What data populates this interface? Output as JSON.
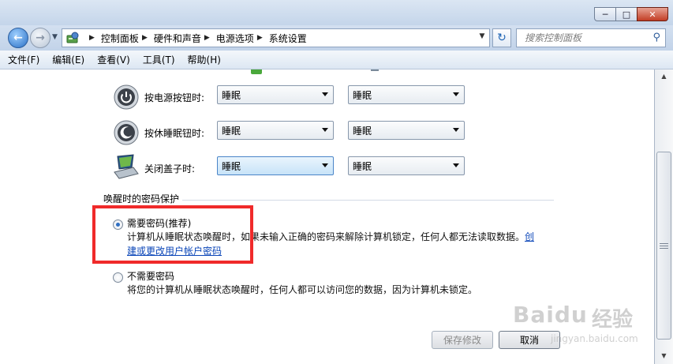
{
  "window": {
    "caption_buttons": {
      "minimize": "─",
      "maximize": "□",
      "close": "✕"
    }
  },
  "address": {
    "breadcrumbs": [
      "控制面板",
      "硬件和声音",
      "电源选项",
      "系统设置"
    ]
  },
  "search": {
    "placeholder": "搜索控制面板"
  },
  "menu": [
    "文件(F)",
    "编辑(E)",
    "查看(V)",
    "工具(T)",
    "帮助(H)"
  ],
  "power_settings": [
    {
      "label": "按电源按钮时:",
      "battery": "睡眠",
      "plugged": "睡眠",
      "icon": "power-button-icon"
    },
    {
      "label": "按休睡眠钮时:",
      "battery": "睡眠",
      "plugged": "睡眠",
      "icon": "sleep-button-icon"
    },
    {
      "label": "关闭盖子时:",
      "battery": "睡眠",
      "plugged": "睡眠",
      "icon": "laptop-lid-icon"
    }
  ],
  "password_group": {
    "title": "唤醒时的密码保护",
    "options": [
      {
        "label": "需要密码(推荐)",
        "selected": true,
        "desc_line1": "计算机从睡眠状态唤醒时，如果未输入正确的密码来解除计算机锁定，任何人都无法读取数据。",
        "link_part1": "创",
        "link_part2": "建或更改用户帐户密码"
      },
      {
        "label": "不需要密码",
        "selected": false,
        "desc_line1": "将您的计算机从睡眠状态唤醒时，任何人都可以访问您的数据，因为计算机未锁定。"
      }
    ]
  },
  "buttons": {
    "save": "保存修改",
    "cancel": "取消"
  },
  "watermark": {
    "brand": "Baidu",
    "brand_cn": "经验",
    "url": "jingyan.baidu.com"
  },
  "colors": {
    "highlight_box": "#f02a2a",
    "link": "#0b46b8",
    "radio_dot": "#2f6fc2"
  }
}
